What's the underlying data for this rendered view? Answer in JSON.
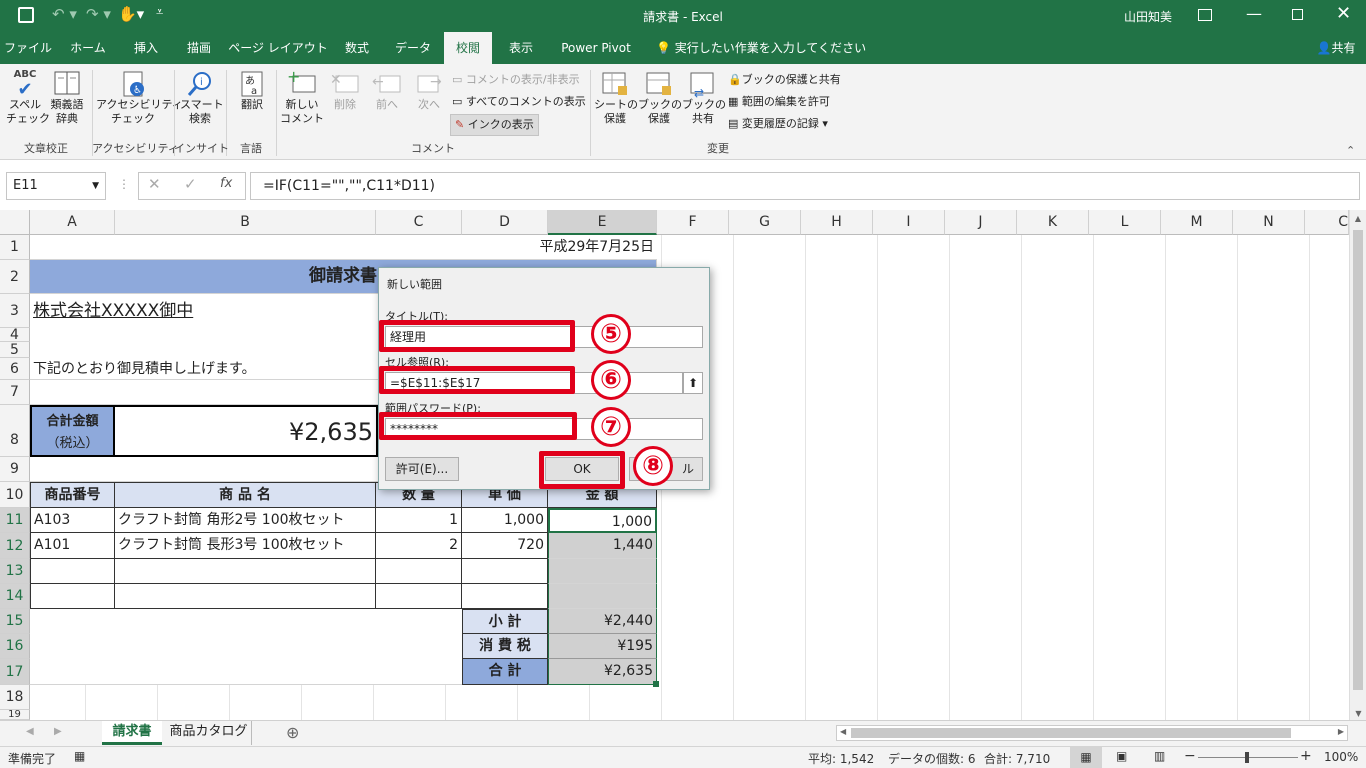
{
  "window": {
    "title": "請求書  -  Excel",
    "user": "山田知美"
  },
  "tabs": [
    "ファイル",
    "ホーム",
    "挿入",
    "描画",
    "ページ レイアウト",
    "数式",
    "データ",
    "校閲",
    "表示",
    "Power Pivot"
  ],
  "tell_me": "実行したい作業を入力してください",
  "share": "共有",
  "ribbon": {
    "proof": {
      "spell": "スペル\nチェック",
      "thesaurus": "類義語\n辞典",
      "abc": "ABC",
      "group": "文章校正"
    },
    "access": {
      "check": "アクセシビリティ\nチェック",
      "group": "アクセシビリティ"
    },
    "insight": {
      "smart": "スマート\n検索",
      "group": "インサイト"
    },
    "lang": {
      "translate": "翻訳",
      "group": "言語"
    },
    "comment": {
      "new": "新しい\nコメント",
      "delete": "削除",
      "prev": "前へ",
      "next": "次へ",
      "show_hide": "コメントの表示/非表示",
      "show_all": "すべてのコメントの表示",
      "show_ink": "インクの表示",
      "group": "コメント"
    },
    "changes": {
      "sheet": "シートの\n保護",
      "book": "ブックの\n保護",
      "share": "ブックの\n共有",
      "protect_share": "ブックの保護と共有",
      "allow_edit": "範囲の編集を許可",
      "track": "変更履歴の記録",
      "group": "変更"
    }
  },
  "formula_bar": {
    "name_box": "E11",
    "formula": "=IF(C11=\"\",\"\",C11*D11)",
    "fx": "fx"
  },
  "columns": [
    "A",
    "B",
    "C",
    "D",
    "E",
    "F",
    "G",
    "H",
    "I",
    "J",
    "K",
    "L",
    "M",
    "N",
    "C"
  ],
  "rows": [
    "1",
    "2",
    "3",
    "4",
    "5",
    "6",
    "7",
    "8",
    "9",
    "10",
    "11",
    "12",
    "13",
    "14",
    "15",
    "16",
    "17",
    "18",
    "19"
  ],
  "sheet": {
    "date": "平成29年7月25日",
    "title": "御請求書",
    "addressee": "株式会社XXXXX御中",
    "message": "下記のとおり御見積申し上げます。",
    "total_label": "合計金額",
    "total_sub": "（税込）",
    "total_value": "¥2,635",
    "headers": {
      "code": "商品番号",
      "name": "商 品 名",
      "qty": "数 量",
      "price": "単 価",
      "amount": "金 額"
    },
    "items": [
      {
        "code": "A103",
        "name": "クラフト封筒 角形2号 100枚セット",
        "qty": "1",
        "price": "1,000",
        "amount": "1,000"
      },
      {
        "code": "A101",
        "name": "クラフト封筒 長形3号 100枚セット",
        "qty": "2",
        "price": "720",
        "amount": "1,440"
      }
    ],
    "subtotal_label": "小 計",
    "subtotal": "¥2,440",
    "tax_label": "消 費 税",
    "tax": "¥195",
    "grand_label": "合 計",
    "grand": "¥2,635"
  },
  "dialog": {
    "title": "新しい範囲",
    "title_label": "タイトル(T):",
    "title_value": "経理用",
    "ref_label": "セル参照(R):",
    "ref_value": "=$E$11:$E$17",
    "pw_label": "範囲パスワード(P):",
    "pw_value": "********",
    "permit": "許可(E)...",
    "ok": "OK",
    "cancel": "ル",
    "callouts": [
      "⑤",
      "⑥",
      "⑦",
      "⑧"
    ]
  },
  "sheet_tabs": [
    "請求書",
    "商品カタログ"
  ],
  "status": {
    "ready": "準備完了",
    "avg": "平均: 1,542",
    "count": "データの個数: 6",
    "sum": "合計: 7,710",
    "zoom": "100%"
  },
  "colors": {
    "excel_green": "#217346",
    "header_blue": "#8ea9db",
    "light_blue": "#d9e1f2",
    "callout_red": "#e0001b",
    "selected_gray": "#d0d0d0"
  }
}
